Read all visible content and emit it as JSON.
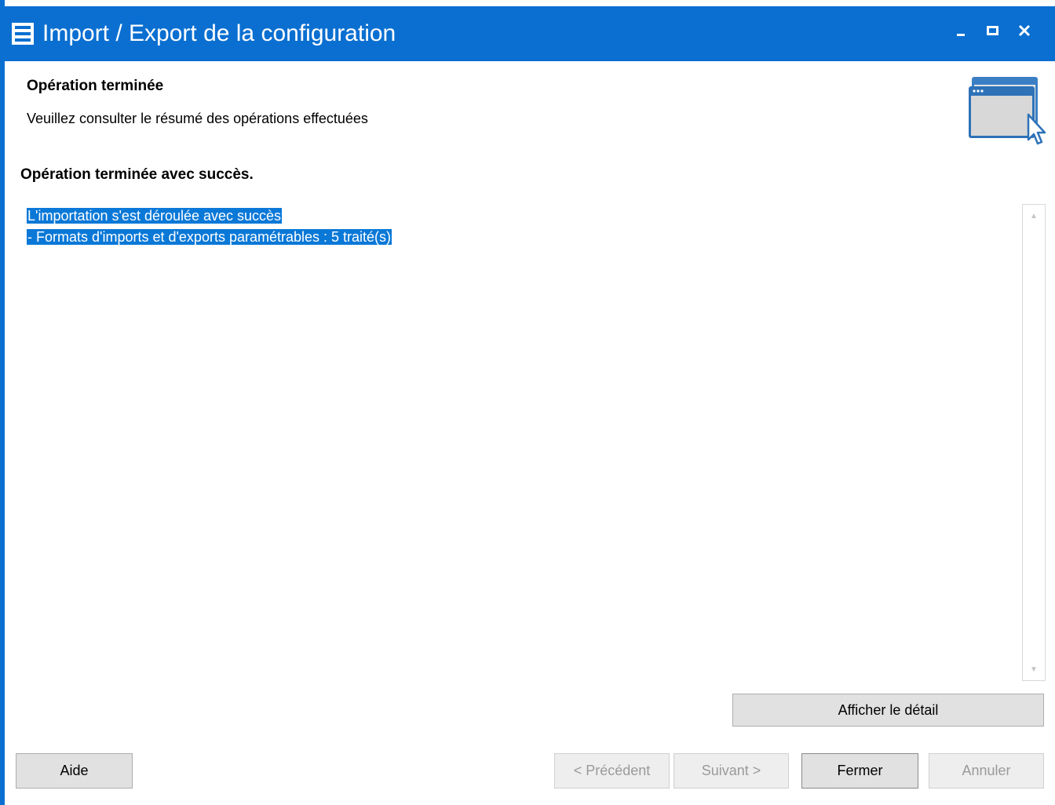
{
  "window": {
    "title": "Import / Export de la configuration",
    "controls": {
      "minimize": "minimize-icon",
      "maximize": "maximize-icon",
      "close": "close-icon"
    },
    "accent_color": "#0a6fd1"
  },
  "header": {
    "title": "Opération terminée",
    "subtitle": "Veuillez consulter le résumé des opérations effectuées",
    "graphic": "window-cursor-icon"
  },
  "status": {
    "message": "Opération terminée avec succès."
  },
  "log": {
    "lines": [
      "L'importation s'est déroulée avec succès",
      "- Formats d'imports et d'exports paramétrables : 5 traité(s)"
    ],
    "selection_color": "#0a78d7"
  },
  "buttons": {
    "details": "Afficher le détail",
    "help": "Aide",
    "previous": "< Précédent",
    "next": "Suivant >",
    "close": "Fermer",
    "cancel": "Annuler"
  }
}
